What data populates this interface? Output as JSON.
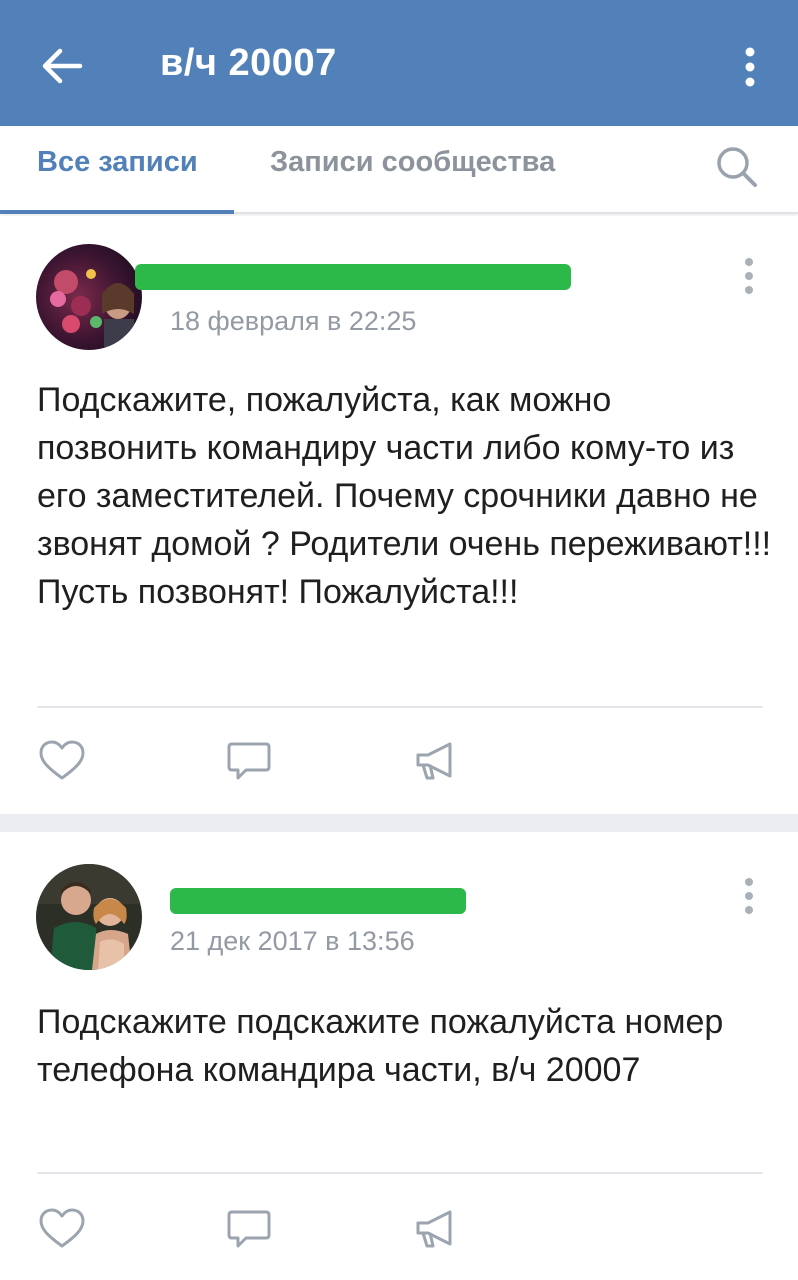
{
  "header": {
    "title": "в/ч 20007",
    "back_icon": "arrow-left-icon",
    "menu_icon": "more-vertical-icon",
    "background": "#5181b8"
  },
  "tabs": {
    "items": [
      {
        "label": "Все записи",
        "active": true
      },
      {
        "label": "Записи сообщества",
        "active": false
      }
    ],
    "search_icon": "search-icon",
    "active_color": "#5181b8",
    "inactive_color": "#8c939c"
  },
  "posts": [
    {
      "author_redacted": true,
      "redaction_color": "#2db84a",
      "date": "18 февраля в 22:25",
      "text": "Подскажите, пожалуйста, как можно позвонить командиру части либо кому-то из его заместителей. Почему срочники давно не звонят домой ? Родители очень переживают!!! Пусть позвонят! Пожалуйста!!!",
      "actions": [
        "heart-icon",
        "comment-icon",
        "megaphone-icon"
      ]
    },
    {
      "author_redacted": true,
      "redaction_color": "#2db84a",
      "date": "21 дек 2017 в 13:56",
      "text": "Подскажите подскажите пожалуйста номер телефона командира части, в/ч 20007",
      "actions": [
        "heart-icon",
        "comment-icon",
        "megaphone-icon"
      ]
    }
  ]
}
